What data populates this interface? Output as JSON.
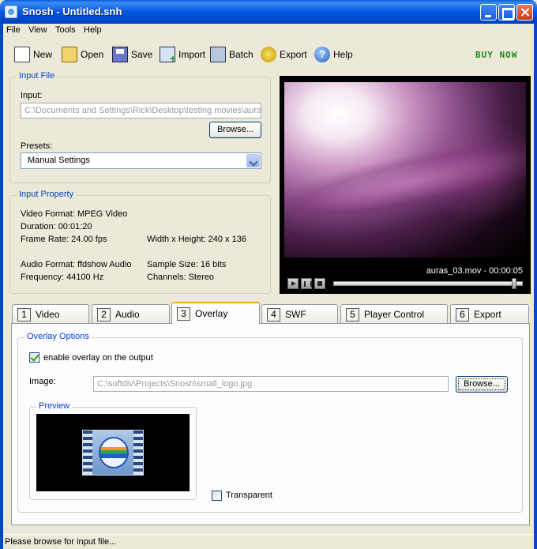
{
  "window": {
    "title": "Snosh - Untitled.snh"
  },
  "menu": [
    "File",
    "View",
    "Tools",
    "Help"
  ],
  "toolbar": {
    "new": "New",
    "open": "Open",
    "save": "Save",
    "import": "Import",
    "batch": "Batch",
    "export": "Export",
    "help": "Help",
    "buy_now": "BUY NOW"
  },
  "input_file": {
    "group_title": "Input File",
    "input_label": "Input:",
    "input_value": "C:\\Documents and Settings\\Rick\\Desktop\\testing movies\\aura",
    "browse_label": "Browse...",
    "presets_label": "Presets:",
    "presets_value": "Manual Settings"
  },
  "input_property": {
    "group_title": "Input Property",
    "video_format": "Video Format: MPEG Video",
    "duration": "Duration: 00:01:20",
    "frame_rate": "Frame Rate: 24.00 fps",
    "size": "Width x Height: 240 x 136",
    "audio_format": "Audio Format: ffdshow Audio",
    "sample_size": "Sample Size: 16 bits",
    "frequency": "Frequency: 44100 Hz",
    "channels": "Channels: Stereo"
  },
  "player": {
    "caption": "auras_03.mov - 00:00:05",
    "progress_fraction": 0.97
  },
  "tabs": [
    {
      "num": "1",
      "label": "Video"
    },
    {
      "num": "2",
      "label": "Audio"
    },
    {
      "num": "3",
      "label": "Overlay"
    },
    {
      "num": "4",
      "label": "SWF"
    },
    {
      "num": "5",
      "label": "Player Control"
    },
    {
      "num": "6",
      "label": "Export"
    }
  ],
  "overlay": {
    "group_title": "Overlay Options",
    "enable_label": "enable overlay on the output",
    "image_label": "Image:",
    "image_value": "C:\\softdiv\\Projects\\Snosh\\small_logo.jpg",
    "browse_label": "Browse...",
    "preview_title": "Preview",
    "transparent_label": "Transparent"
  },
  "status": {
    "text": "Please browse for input file..."
  }
}
